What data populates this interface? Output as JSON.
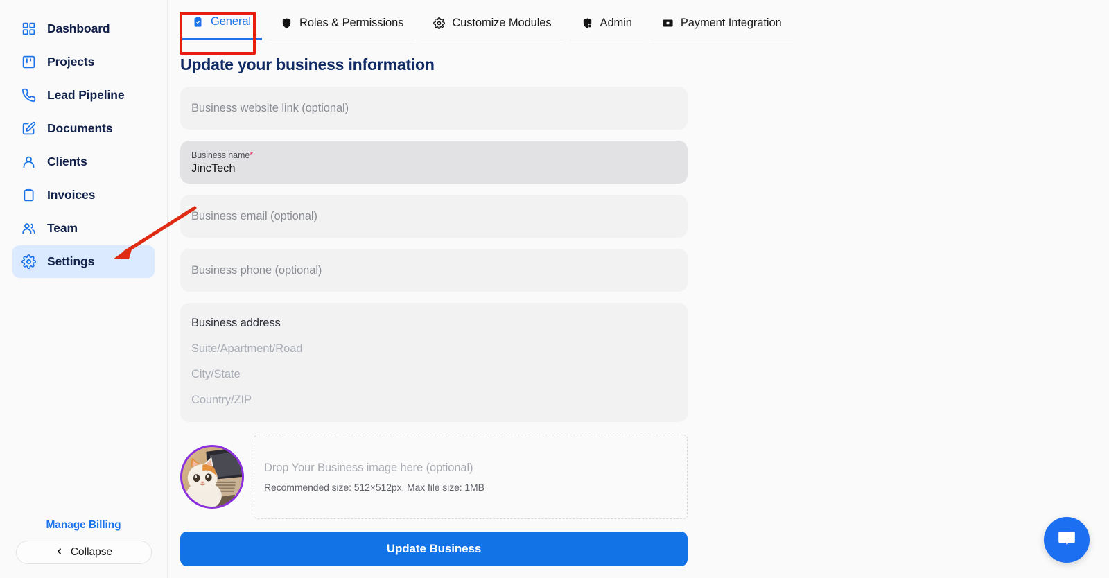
{
  "sidebar": {
    "items": [
      {
        "label": "Dashboard",
        "icon": "grid-icon",
        "active": false
      },
      {
        "label": "Projects",
        "icon": "kanban-board-icon",
        "active": false
      },
      {
        "label": "Lead Pipeline",
        "icon": "phone-icon",
        "active": false
      },
      {
        "label": "Documents",
        "icon": "edit-document-icon",
        "active": false
      },
      {
        "label": "Clients",
        "icon": "user-icon",
        "active": false
      },
      {
        "label": "Invoices",
        "icon": "clipboard-icon",
        "active": false
      },
      {
        "label": "Team",
        "icon": "users-icon",
        "active": false
      },
      {
        "label": "Settings",
        "icon": "gear-icon",
        "active": true
      }
    ],
    "manage_billing": "Manage Billing",
    "collapse": "Collapse",
    "collapse_chevron": "‹"
  },
  "tabs": [
    {
      "label": "General",
      "icon": "clipboard-check-icon",
      "active": true
    },
    {
      "label": "Roles & Permissions",
      "icon": "shield-icon",
      "active": false
    },
    {
      "label": "Customize Modules",
      "icon": "gear-icon",
      "active": false
    },
    {
      "label": "Admin",
      "icon": "shield-user-icon",
      "active": false
    },
    {
      "label": "Payment Integration",
      "icon": "card-icon",
      "active": false
    }
  ],
  "page": {
    "title": "Update your business information"
  },
  "form": {
    "website": {
      "placeholder": "Business website link (optional)",
      "value": ""
    },
    "business_name": {
      "label": "Business name",
      "required_marker": "*",
      "value": "JincTech"
    },
    "email": {
      "placeholder": "Business email (optional)",
      "value": ""
    },
    "phone": {
      "placeholder": "Business phone (optional)",
      "value": ""
    },
    "address": {
      "title": "Business address",
      "line1_placeholder": "Suite/Apartment/Road",
      "line2_placeholder": "City/State",
      "line3_placeholder": "Country/ZIP"
    },
    "upload": {
      "main": "Drop Your Business image here (optional)",
      "sub": "Recommended size: 512×512px, Max file size: 1MB",
      "avatar_alt": "cat-in-front-of-laptop-photo"
    },
    "submit_label": "Update Business"
  },
  "chat": {
    "icon": "chat-bubble-icon"
  },
  "colors": {
    "accent_blue": "#1273e6",
    "link_blue": "#1a73e8",
    "sidebar_active_bg": "#dbeafe",
    "title_navy": "#112a63",
    "field_bg": "#f2f2f3",
    "field_filled_bg": "#e2e2e4",
    "required_pink": "#ef2c63",
    "avatar_ring": "#8b2ee0",
    "annotation_red": "#e81d0d"
  }
}
